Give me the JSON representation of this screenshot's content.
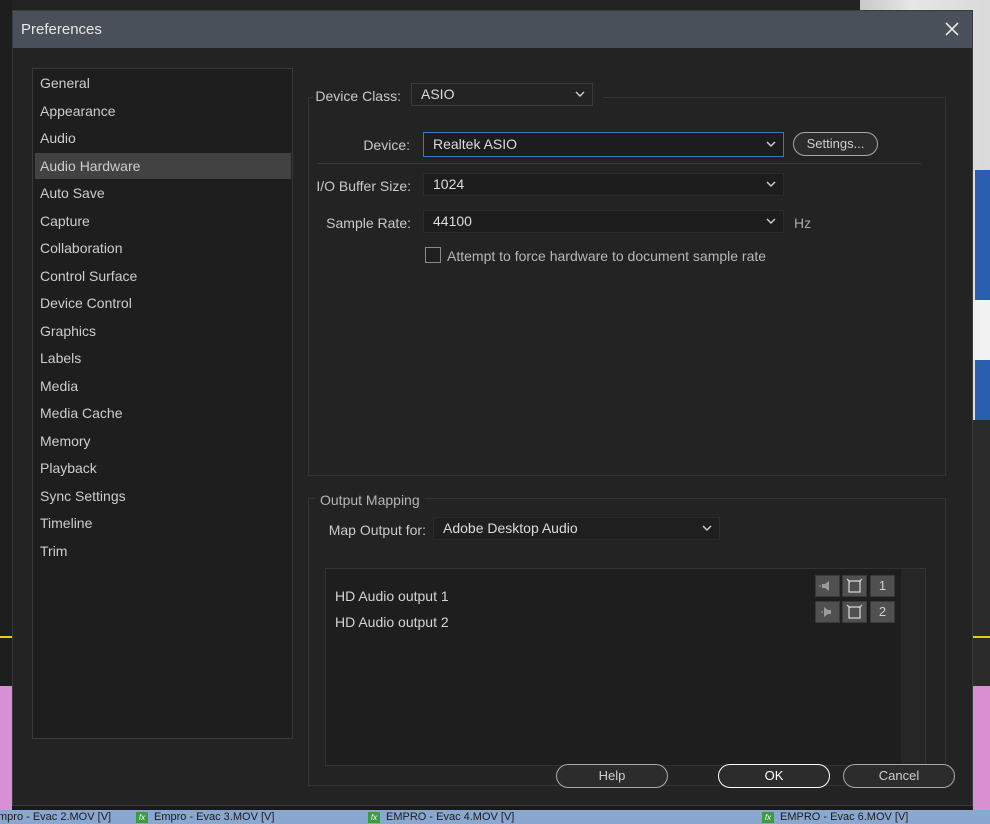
{
  "window": {
    "title": "Preferences"
  },
  "sidebar": {
    "items": [
      {
        "label": "General"
      },
      {
        "label": "Appearance"
      },
      {
        "label": "Audio"
      },
      {
        "label": "Audio Hardware"
      },
      {
        "label": "Auto Save"
      },
      {
        "label": "Capture"
      },
      {
        "label": "Collaboration"
      },
      {
        "label": "Control Surface"
      },
      {
        "label": "Device Control"
      },
      {
        "label": "Graphics"
      },
      {
        "label": "Labels"
      },
      {
        "label": "Media"
      },
      {
        "label": "Media Cache"
      },
      {
        "label": "Memory"
      },
      {
        "label": "Playback"
      },
      {
        "label": "Sync Settings"
      },
      {
        "label": "Timeline"
      },
      {
        "label": "Trim"
      }
    ],
    "selected": "Audio Hardware"
  },
  "device": {
    "class_label": "Device Class:",
    "class_value": "ASIO",
    "device_label": "Device:",
    "device_value": "Realtek ASIO",
    "settings_label": "Settings...",
    "buffer_label": "I/O Buffer Size:",
    "buffer_value": "1024",
    "rate_label": "Sample Rate:",
    "rate_value": "44100",
    "rate_unit": "Hz",
    "force_label": "Attempt to force hardware to document sample rate",
    "force_checked": false
  },
  "output": {
    "group_label": "Output Mapping",
    "map_label": "Map Output for:",
    "map_value": "Adobe Desktop Audio",
    "rows": [
      {
        "label": "HD Audio output 1",
        "channel": "1"
      },
      {
        "label": "HD Audio output 2",
        "channel": "2"
      }
    ]
  },
  "buttons": {
    "help": "Help",
    "ok": "OK",
    "cancel": "Cancel"
  },
  "background": {
    "clips": [
      "mpro - Evac 2.MOV [V]",
      "Empro - Evac 3.MOV [V]",
      "EMPRO - Evac 4.MOV [V]",
      "EMPRO - Evac 6.MOV [V]"
    ],
    "fx_label": "fx"
  },
  "colors": {
    "accent": "#3d76c2",
    "titlebar": "#4a5059",
    "selection": "#424242"
  }
}
